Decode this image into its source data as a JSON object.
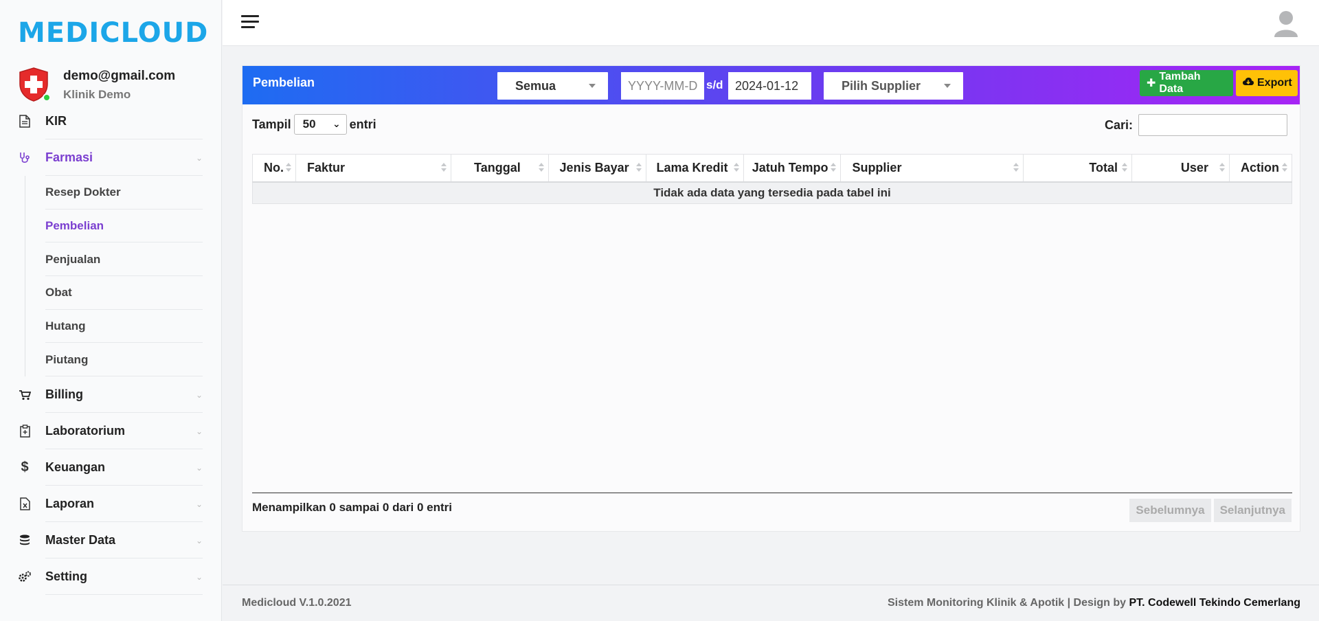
{
  "brand": {
    "logo": "MEDICLOUD",
    "color": "#1ca6e8"
  },
  "user": {
    "email": "demo@gmail.com",
    "clinic": "Klinik Demo"
  },
  "sidebar": {
    "items": [
      {
        "label": "KIR",
        "icon": "document-icon"
      },
      {
        "label": "Farmasi",
        "icon": "stethoscope-icon",
        "expanded": true,
        "children": [
          "Resep Dokter",
          "Pembelian",
          "Penjualan",
          "Obat",
          "Hutang",
          "Piutang"
        ],
        "active_child": "Pembelian"
      },
      {
        "label": "Billing",
        "icon": "cart-icon"
      },
      {
        "label": "Laboratorium",
        "icon": "clipboard-icon"
      },
      {
        "label": "Keuangan",
        "icon": "dollar-icon"
      },
      {
        "label": "Laporan",
        "icon": "excel-file-icon"
      },
      {
        "label": "Master Data",
        "icon": "database-icon"
      },
      {
        "label": "Setting",
        "icon": "gears-icon"
      }
    ],
    "active_color": "#7b3fd0"
  },
  "card": {
    "title": "Pembelian",
    "filter_type": "Semua",
    "date_from_placeholder": "YYYY-MM-D",
    "date_separator": "s/d",
    "date_to": "2024-01-12",
    "supplier_placeholder": "Pilih Supplier",
    "add_button": "Tambah Data",
    "export_button": "Export",
    "colors": {
      "header_start": "#1e6cf2",
      "header_end": "#a724f5",
      "add": "#28a745",
      "export": "#ffc107"
    }
  },
  "table": {
    "show_label": "Tampil",
    "page_length": "50",
    "entries_label": "entri",
    "search_label": "Cari:",
    "columns": [
      "No.",
      "Faktur",
      "Tanggal",
      "Jenis Bayar",
      "Lama Kredit",
      "Jatuh Tempo",
      "Supplier",
      "Total",
      "User",
      "Action"
    ],
    "empty_message": "Tidak ada data yang tersedia pada tabel ini",
    "info": "Menampilkan 0 sampai 0 dari 0 entri",
    "prev": "Sebelumnya",
    "next": "Selanjutnya"
  },
  "footer": {
    "version": "Medicloud V.1.0.2021",
    "credit_prefix": "Sistem Monitoring Klinik & Apotik | Design by",
    "credit_company": "PT. Codewell Tekindo Cemerlang"
  }
}
